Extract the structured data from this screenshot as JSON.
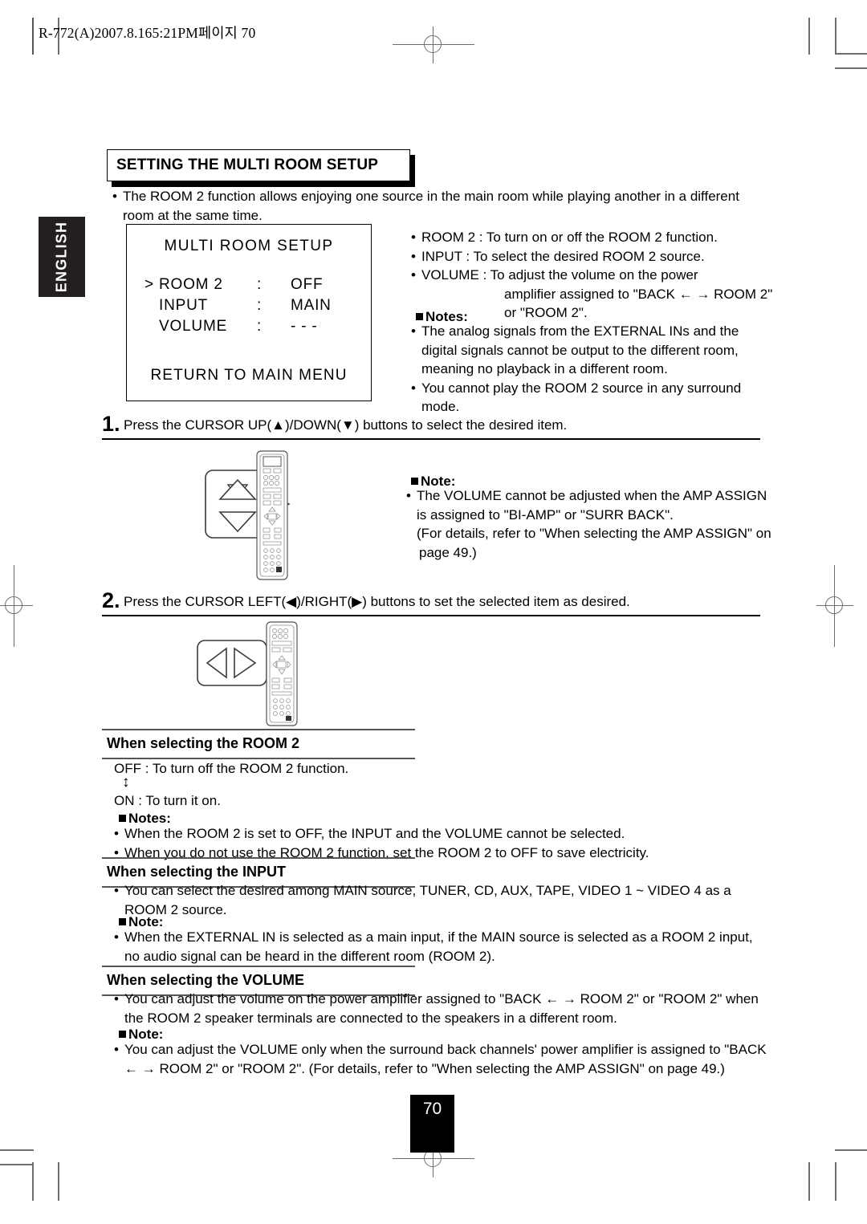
{
  "header": {
    "slug": "R-772(A)2007.8.165:21PM페이지 70"
  },
  "side_tab": {
    "label": "ENGLISH"
  },
  "section": {
    "title": "SETTING THE MULTI ROOM SETUP",
    "intro": "The ROOM 2 function allows enjoying one source in the main room while playing another in a different room at the same time."
  },
  "osd": {
    "title": "MULTI  ROOM  SETUP",
    "rows": [
      {
        "cursor": ">",
        "name": "ROOM  2",
        "colon": ":",
        "value": "OFF"
      },
      {
        "cursor": "",
        "name": "INPUT",
        "colon": ":",
        "value": "MAIN"
      },
      {
        "cursor": "",
        "name": "VOLUME",
        "colon": ":",
        "value": "- - -"
      }
    ],
    "footer": "RETURN  TO  MAIN  MENU"
  },
  "right_column": {
    "items": [
      "ROOM 2 : To turn on or off the ROOM 2 function.",
      "INPUT : To select the desired ROOM 2 source.",
      "VOLUME : To adjust the volume on the power"
    ],
    "volume_cont_1": "amplifier assigned to \"BACK ←  → ROOM 2\"",
    "volume_cont_2": "or \"ROOM 2\".",
    "notes_label": "Notes:",
    "notes": [
      "The analog signals from the EXTERNAL INs and the digital signals cannot be output to the different room, meaning no playback in a different room.",
      "You cannot play the ROOM 2 source in any surround mode."
    ]
  },
  "steps": [
    {
      "number": "1.",
      "text": "Press the CURSOR UP(▲)/DOWN(▼) buttons to select the desired item."
    },
    {
      "number": "2.",
      "text": "Press the CURSOR LEFT(◀)/RIGHT(▶) buttons to set the selected item as desired."
    }
  ],
  "step1_note": {
    "label": "Note:",
    "lines": [
      "The VOLUME cannot be adjusted when the AMP ASSIGN",
      "is assigned to \"BI-AMP\" or \"SURR BACK\".",
      "(For details, refer to \"When selecting the AMP ASSIGN\" on",
      "page 49.)"
    ]
  },
  "room2_section": {
    "heading": "When selecting the ROOM 2",
    "off_line": "OFF : To turn off the ROOM 2 function.",
    "arrow": "↕",
    "on_line": "ON : To turn it on.",
    "notes_label": "Notes:",
    "notes": [
      "When the ROOM 2 is set to OFF, the INPUT and the VOLUME cannot be selected.",
      "When you do not use the ROOM 2 function, set the ROOM 2 to OFF to save electricity."
    ]
  },
  "input_section": {
    "heading": "When selecting the INPUT",
    "bullets": [
      "You can select the desired among MAIN source, TUNER, CD, AUX, TAPE, VIDEO 1 ~ VIDEO 4 as a ROOM 2 source."
    ],
    "note_label": "Note:",
    "notes": [
      "When the EXTERNAL IN is selected as a main input, if the MAIN source is selected as a ROOM 2 input, no audio signal can be heard in the different room (ROOM 2)."
    ]
  },
  "volume_section": {
    "heading": "When selecting the VOLUME",
    "bullet_line_1": "You can adjust the volume on the power amplifier assigned to \"BACK ←  → ROOM 2\" or \"ROOM 2\" when",
    "bullet_line_2": "the ROOM 2 speaker terminals are connected to the speakers in a different room.",
    "note_label": "Note:",
    "note_line_1": "You can adjust the VOLUME only when the surround back channels' power amplifier is assigned to \"BACK",
    "note_line_2": "←  → ROOM 2\" or \"ROOM 2\". (For details, refer to \"When selecting the AMP ASSIGN\" on page 49.)"
  },
  "footer": {
    "page_number": "70"
  }
}
